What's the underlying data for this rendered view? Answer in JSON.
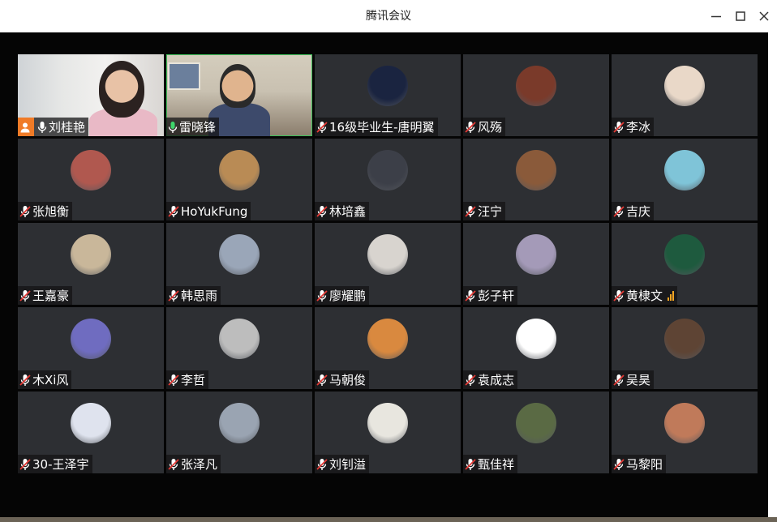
{
  "window": {
    "title": "腾讯会议",
    "minimize_label": "minimize",
    "maximize_label": "maximize",
    "close_label": "close"
  },
  "participants": [
    {
      "name": "刘桂艳",
      "mic": "on",
      "host": true,
      "video": true
    },
    {
      "name": "雷晓锋",
      "mic": "on",
      "host": false,
      "video": true,
      "active_speaker": true
    },
    {
      "name": "16级毕业生-唐明翼",
      "mic": "muted",
      "avatar_color": "#1a2440"
    },
    {
      "name": "风殇",
      "mic": "muted",
      "avatar_color": "#7a3a2a"
    },
    {
      "name": "李冰",
      "mic": "muted",
      "avatar_color": "#e9d8c8"
    },
    {
      "name": "张旭衡",
      "mic": "muted",
      "avatar_color": "#b0584f"
    },
    {
      "name": "HoYukFung",
      "mic": "muted",
      "avatar_color": "#b98b55"
    },
    {
      "name": "林培鑫",
      "mic": "muted",
      "avatar_color": "#3c3f48"
    },
    {
      "name": " 汪宁",
      "mic": "muted",
      "avatar_color": "#8a5a3a"
    },
    {
      "name": "吉庆",
      "mic": "muted",
      "avatar_color": "#7fc4d8"
    },
    {
      "name": "王嘉豪",
      "mic": "muted",
      "avatar_color": "#c9b79a"
    },
    {
      "name": "韩思雨",
      "mic": "muted",
      "avatar_color": "#9aa6b8"
    },
    {
      "name": "廖耀鹏",
      "mic": "muted",
      "avatar_color": "#d8d4cf"
    },
    {
      "name": "彭子轩",
      "mic": "muted",
      "avatar_color": "#a49ab8"
    },
    {
      "name": "黄棣文",
      "mic": "muted",
      "avatar_color": "#1e5a3e",
      "signal_bars": 3
    },
    {
      "name": "木Xi风",
      "mic": "muted",
      "avatar_color": "#6f6cc0"
    },
    {
      "name": "李哲",
      "mic": "muted",
      "avatar_color": "#bdbdbd"
    },
    {
      "name": "马朝俊",
      "mic": "muted",
      "avatar_color": "#d9893f"
    },
    {
      "name": "袁成志",
      "mic": "muted",
      "avatar_color": "#ffffff"
    },
    {
      "name": "吴昊",
      "mic": "muted",
      "avatar_color": "#5e4434"
    },
    {
      "name": "30-王泽宇",
      "mic": "muted",
      "avatar_color": "#dfe3ee"
    },
    {
      "name": "张泽凡",
      "mic": "muted",
      "avatar_color": "#9aa4b2"
    },
    {
      "name": "刘钊溢",
      "mic": "muted",
      "avatar_color": "#e8e6df"
    },
    {
      "name": "甄佳祥",
      "mic": "muted",
      "avatar_color": "#5a6a44"
    },
    {
      "name": "马黎阳",
      "mic": "muted",
      "avatar_color": "#c07a5a"
    }
  ]
}
